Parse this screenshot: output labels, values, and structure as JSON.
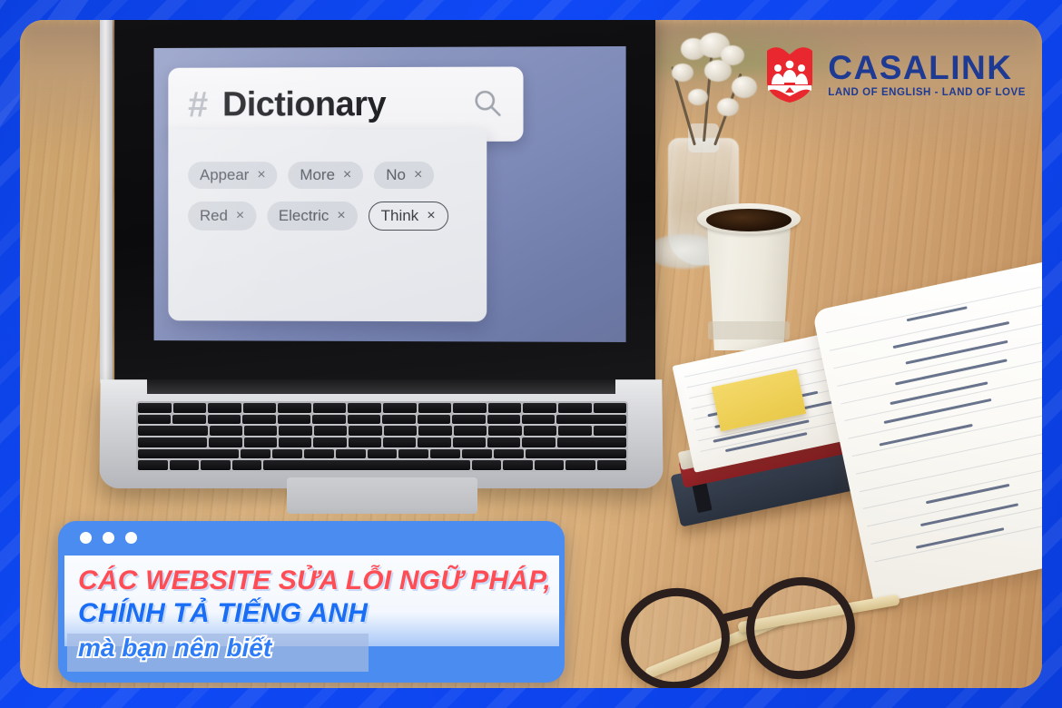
{
  "theme": {
    "frame_blue": "#0c46f0",
    "banner_blue": "#4a8cf0",
    "title_red": "#ff4d56",
    "title_blue": "#1a6ef5",
    "logo_navy": "#1f3a93",
    "logo_red": "#e8272f"
  },
  "logo": {
    "name": "CASALINK",
    "tagline": "LAND OF ENGLISH - LAND OF LOVE",
    "shield_icon": "shield-three-people-icon"
  },
  "dictionary": {
    "hash": "#",
    "title": "Dictionary",
    "search_icon": "search-icon",
    "tags": [
      {
        "label": "Appear",
        "close": "×",
        "outlined": false
      },
      {
        "label": "More",
        "close": "×",
        "outlined": false
      },
      {
        "label": "No",
        "close": "×",
        "outlined": false
      },
      {
        "label": "Red",
        "close": "×",
        "outlined": false
      },
      {
        "label": "Electric",
        "close": "×",
        "outlined": false
      },
      {
        "label": "Think",
        "close": "×",
        "outlined": true
      }
    ]
  },
  "banner": {
    "window_dots": 3,
    "line1": "CÁC WEBSITE SỬA LỖI NGỮ PHÁP,",
    "line2": "CHÍNH TẢ TIẾNG ANH",
    "line3": "mà bạn nên biết"
  },
  "photo_objects": [
    "laptop",
    "coffee-cup",
    "flower-vase",
    "notebooks",
    "sticky-note",
    "eyeglasses",
    "wooden-desk"
  ]
}
